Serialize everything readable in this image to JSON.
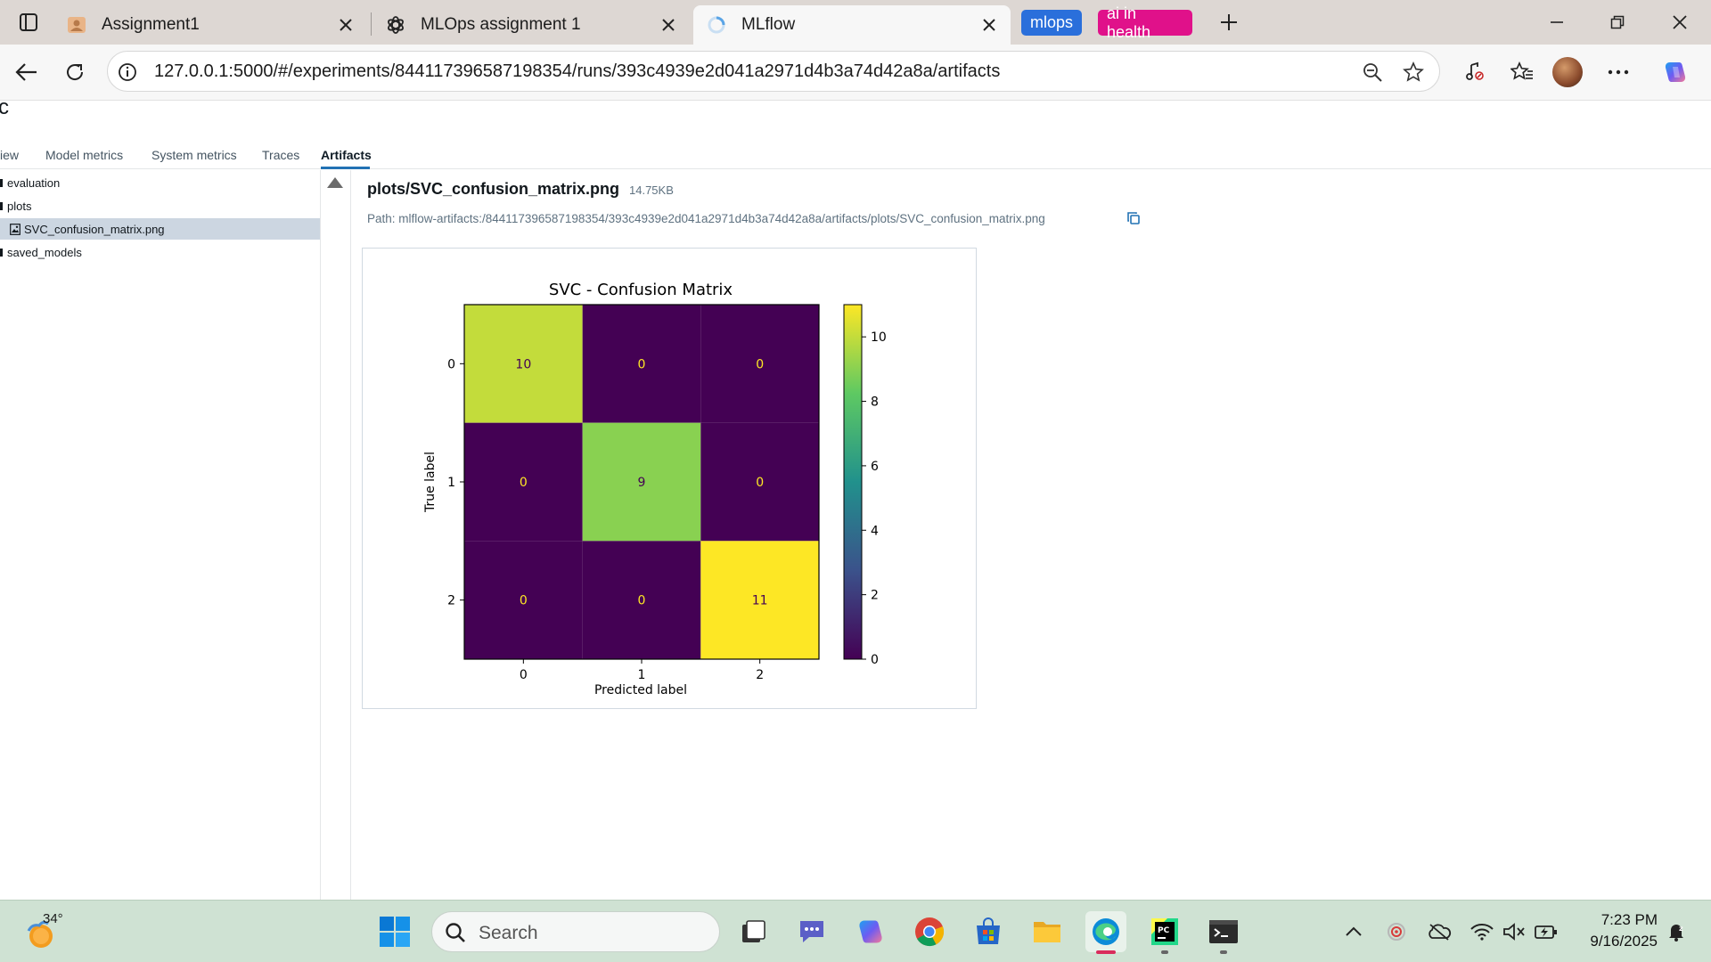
{
  "browser": {
    "tabs": [
      {
        "title": "Assignment1",
        "icon": "document-person-icon"
      },
      {
        "title": "MLOps assignment 1",
        "icon": "openai-icon"
      },
      {
        "title": "MLflow",
        "icon": "loading-icon",
        "active": true
      }
    ],
    "tab_groups": [
      {
        "label": "mlops",
        "color": "#2a6fdb"
      },
      {
        "label": "ai in health",
        "color": "#e0118a"
      }
    ],
    "address": "127.0.0.1:5000/#/experiments/844117396587198354/runs/393c4939e2d041a2971d4b3a74d42a8a/artifacts"
  },
  "page": {
    "heading_fragment": "c",
    "run_tabs": [
      {
        "label": "iew"
      },
      {
        "label": "Model metrics"
      },
      {
        "label": "System metrics"
      },
      {
        "label": "Traces"
      },
      {
        "label": "Artifacts",
        "active": true
      }
    ],
    "tree": [
      {
        "label": "evaluation",
        "type": "folder"
      },
      {
        "label": "plots",
        "type": "folder"
      },
      {
        "label": "SVC_confusion_matrix.png",
        "type": "file",
        "selected": true
      },
      {
        "label": "saved_models",
        "type": "folder"
      }
    ],
    "artifact": {
      "name": "plots/SVC_confusion_matrix.png",
      "size": "14.75KB",
      "path": "Path: mlflow-artifacts:/844117396587198354/393c4939e2d041a2971d4b3a74d42a8a/artifacts/plots/SVC_confusion_matrix.png"
    }
  },
  "chart_data": {
    "type": "heatmap",
    "title": "SVC - Confusion Matrix",
    "xlabel": "Predicted label",
    "ylabel": "True label",
    "x_categories": [
      "0",
      "1",
      "2"
    ],
    "y_categories": [
      "0",
      "1",
      "2"
    ],
    "values": [
      [
        10,
        0,
        0
      ],
      [
        0,
        9,
        0
      ],
      [
        0,
        0,
        11
      ]
    ],
    "colormap": "viridis",
    "colorbar": {
      "min": 0,
      "max": 11,
      "ticks": [
        0,
        2,
        4,
        6,
        8,
        10
      ]
    }
  },
  "taskbar": {
    "weather_temp": "34°",
    "search_placeholder": "Search",
    "apps": [
      "start-icon",
      "search",
      "task-view-icon",
      "chat-icon",
      "copilot-icon",
      "chrome-icon",
      "store-icon",
      "file-explorer-icon",
      "edge-icon",
      "pycharm-icon",
      "terminal-icon"
    ],
    "time": "7:23 PM",
    "date": "9/16/2025"
  }
}
